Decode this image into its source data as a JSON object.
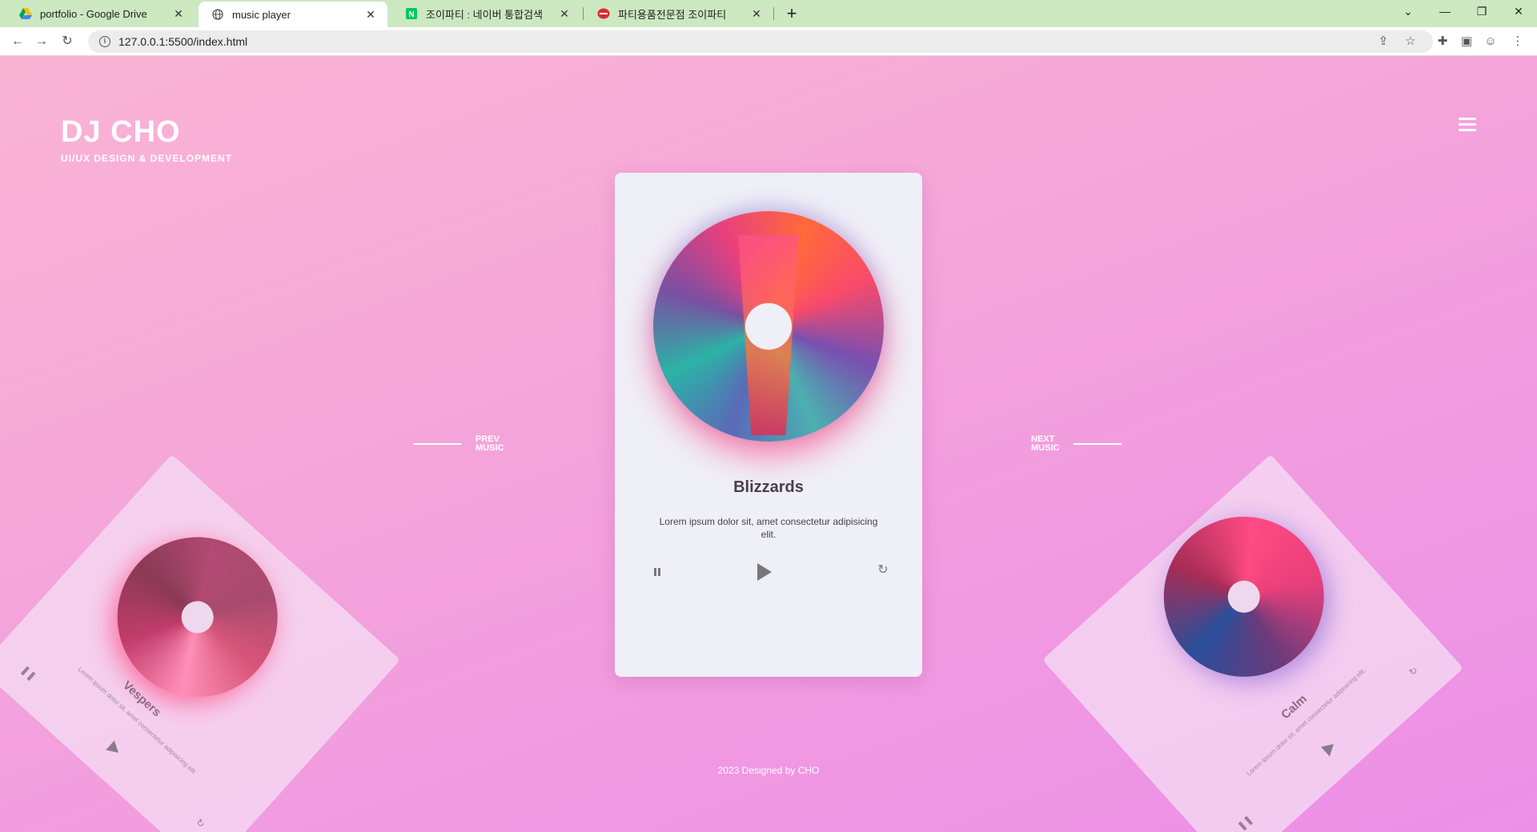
{
  "browser": {
    "tabs": [
      {
        "title": "portfolio - Google Drive",
        "icon": "google-drive-icon"
      },
      {
        "title": "music player",
        "icon": "globe-icon"
      },
      {
        "title": "조이파티 : 네이버 통합검색",
        "icon": "naver-icon"
      },
      {
        "title": "파티용품전문점 조이파티",
        "icon": "joyparty-icon"
      }
    ],
    "url": "127.0.0.1:5500/index.html"
  },
  "site": {
    "brand_title": "DJ CHO",
    "brand_sub": "UI/UX DESIGN & DEVELOPMENT",
    "prev_label_1": "PREV",
    "prev_label_2": "MUSIC",
    "next_label_1": "NEXT",
    "next_label_2": "MUSIC",
    "footer": "2023 Designed by CHO"
  },
  "player": {
    "current": {
      "title": "Blizzards",
      "description": "Lorem ipsum dolor sit, amet consectetur adipisicing elit."
    },
    "prev": {
      "title": "Vespers",
      "description": "Lorem ipsum dolor sit, amet consectetur adipisicing elit."
    },
    "next": {
      "title": "Calm",
      "description": "Lorem ipsum dolor sit, amet consectetur adipisicing elit."
    }
  },
  "colors": {
    "tab_bar": "#cce8c1",
    "card_bg": "#efeff8",
    "text_dark": "#4a4049"
  }
}
